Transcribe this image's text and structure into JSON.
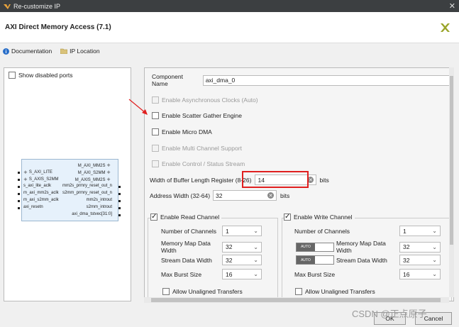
{
  "window": {
    "title": "Re-customize IP"
  },
  "header": {
    "ip_title": "AXI Direct Memory Access (7.1)"
  },
  "toolbar": {
    "documentation": "Documentation",
    "ip_location": "IP Location"
  },
  "left": {
    "show_disabled_ports": "Show disabled ports",
    "block": {
      "left_pins": [
        "S_AXI_LITE",
        "S_AXIS_S2MM",
        "s_axi_lite_aclk",
        "m_axi_mm2s_aclk",
        "m_axi_s2mm_aclk",
        "axi_resetn"
      ],
      "right_pins": [
        "M_AXI_MM2S",
        "M_AXI_S2MM",
        "M_AXIS_MM2S",
        "mm2s_prmry_reset_out_n",
        "s2mm_prmry_reset_out_n",
        "mm2s_introut",
        "s2mm_introut",
        "axi_dma_tstvec[31:0]"
      ]
    }
  },
  "config": {
    "component_name_label": "Component Name",
    "component_name_value": "axi_dma_0",
    "enable_async_clocks": "Enable Asynchronous Clocks (Auto)",
    "enable_scatter_gather": "Enable Scatter Gather Engine",
    "enable_micro_dma": "Enable Micro DMA",
    "enable_multi_channel": "Enable Multi Channel Support",
    "enable_control_status": "Enable Control / Status Stream",
    "buffer_length_label": "Width of Buffer Length Register (8-26)",
    "buffer_length_value": "14",
    "buffer_length_unit": "bits",
    "address_width_label": "Address Width (32-64)",
    "address_width_value": "32",
    "address_width_unit": "bits",
    "read_channel": {
      "label": "Enable Read Channel",
      "num_channels_label": "Number of Channels",
      "num_channels_value": "1",
      "mm_data_width_label": "Memory Map Data Width",
      "mm_data_width_value": "32",
      "stream_data_width_label": "Stream Data Width",
      "stream_data_width_value": "32",
      "max_burst_label": "Max Burst Size",
      "max_burst_value": "16",
      "unaligned_label": "Allow Unaligned Transfers"
    },
    "write_channel": {
      "label": "Enable Write Channel",
      "num_channels_label": "Number of Channels",
      "num_channels_value": "1",
      "auto_label": "AUTO",
      "mm_data_width_label": "Memory Map Data Width",
      "mm_data_width_value": "32",
      "stream_data_width_label": "Stream Data Width",
      "stream_data_width_value": "32",
      "max_burst_label": "Max Burst Size",
      "max_burst_value": "16",
      "unaligned_label": "Allow Unaligned Transfers"
    }
  },
  "buttons": {
    "ok": "OK",
    "cancel": "Cancel"
  },
  "watermark": "CSDN @正点原子",
  "colors": {
    "titlebar": "#3c3f41",
    "highlight_box": "#e02020",
    "arrow": "#e02020",
    "block_fill": "#e6f1fb"
  }
}
